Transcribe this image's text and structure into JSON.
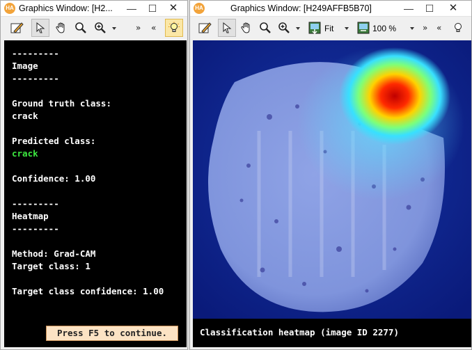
{
  "windows": {
    "left": {
      "title": "Graphics Window: [H2...",
      "app_icon": "HA",
      "icons": [
        "edit-icon",
        "pointer-icon",
        "hand-icon",
        "magnifier-icon",
        "zoom-icon",
        "chevron-down-icon",
        "double-right-icon",
        "double-left-icon",
        "bulb-icon"
      ],
      "nav_forward": "»",
      "nav_back": "«",
      "text_lines": [
        "---------",
        "Image",
        "---------",
        "",
        "Ground truth class:",
        "crack",
        "",
        "Predicted class:",
        "crack",
        "",
        "Confidence: 1.00",
        "",
        "---------",
        "Heatmap",
        "---------",
        "",
        "Method: Grad-CAM",
        "Target class: 1",
        "",
        "Target class confidence: 1.00"
      ],
      "continue_button": "Press F5 to continue."
    },
    "right": {
      "title": "Graphics Window: [H249AFFB5B70]",
      "app_icon": "HA",
      "fit_label": "Fit",
      "zoom_label": "100 %",
      "nav_forward": "»",
      "nav_back": "«",
      "caption": "Classification heatmap (image ID 2277)"
    },
    "titlebar_buttons": {
      "minimize": "—",
      "maximize": "☐",
      "close": "✕"
    }
  },
  "colors": {
    "predicted_class": "#3de840",
    "canvas_bg": "#000000",
    "continue_bg": "#fce3c4"
  }
}
